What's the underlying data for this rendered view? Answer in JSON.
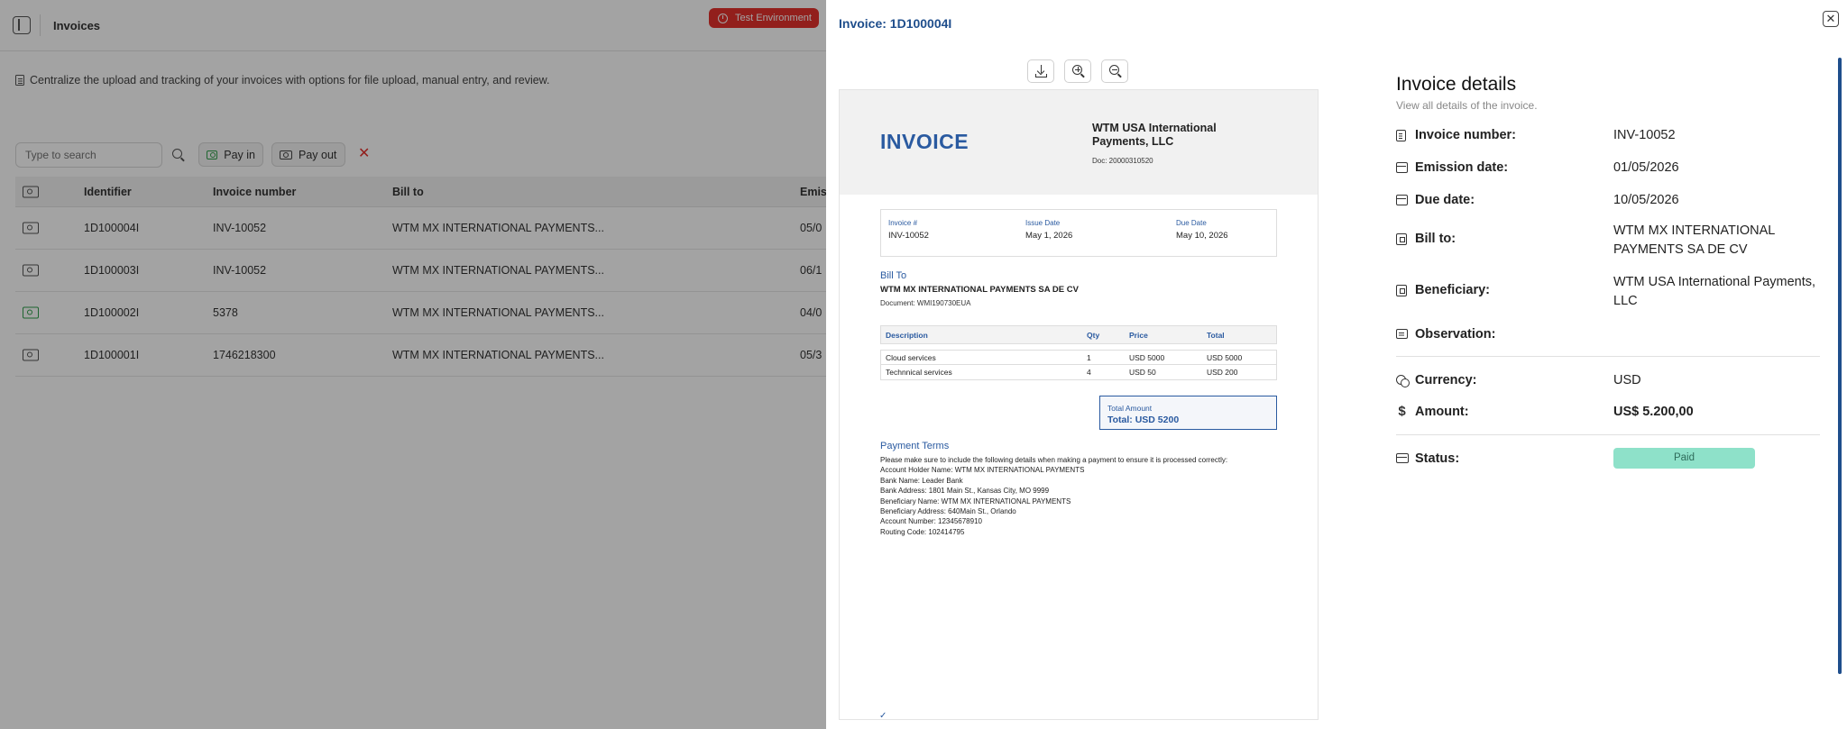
{
  "app": {
    "page_title": "Invoices",
    "environment_badge": "Test Environment",
    "description": "Centralize the upload and tracking of your invoices with options for file upload, manual entry, and review.",
    "search": {
      "placeholder": "Type to search"
    },
    "filters": {
      "pay_in": "Pay in",
      "pay_out": "Pay out"
    },
    "table": {
      "headers": {
        "identifier": "Identifier",
        "invoice_number": "Invoice number",
        "bill_to": "Bill to",
        "emission": "Emis"
      },
      "rows": [
        {
          "identifier": "1D100004I",
          "invoice_number": "INV-10052",
          "bill_to": "WTM MX INTERNATIONAL PAYMENTS...",
          "emission": "05/0",
          "direction": "pay-out"
        },
        {
          "identifier": "1D100003I",
          "invoice_number": "INV-10052",
          "bill_to": "WTM MX INTERNATIONAL PAYMENTS...",
          "emission": "06/1",
          "direction": "pay-out"
        },
        {
          "identifier": "1D100002I",
          "invoice_number": "5378",
          "bill_to": "WTM MX INTERNATIONAL PAYMENTS...",
          "emission": "04/0",
          "direction": "pay-in"
        },
        {
          "identifier": "1D100001I",
          "invoice_number": "1746218300",
          "bill_to": "WTM MX INTERNATIONAL PAYMENTS...",
          "emission": "05/3",
          "direction": "pay-out"
        }
      ]
    }
  },
  "drawer": {
    "title": "Invoice: 1D100004I",
    "document": {
      "heading": "INVOICE",
      "company": "WTM USA International Payments, LLC",
      "doc_number": "Doc: 20000310520",
      "meta": {
        "invoice_label": "Invoice #",
        "invoice_value": "INV-10052",
        "issue_label": "Issue Date",
        "issue_value": "May 1, 2026",
        "due_label": "Due Date",
        "due_value": "May 10, 2026"
      },
      "bill_to": {
        "title": "Bill To",
        "name": "WTM MX INTERNATIONAL PAYMENTS SA DE CV",
        "document": "Document: WMI190730EUA"
      },
      "items_headers": {
        "description": "Description",
        "qty": "Qty",
        "price": "Price",
        "total": "Total"
      },
      "items": [
        {
          "description": "Cloud services",
          "qty": "1",
          "price": "USD 5000",
          "total": "USD 5000"
        },
        {
          "description": "Technnical services",
          "qty": "4",
          "price": "USD 50",
          "total": "USD 200"
        }
      ],
      "total_label": "Total Amount",
      "total_value": "Total: USD 5200",
      "payment_terms_title": "Payment Terms",
      "payment_terms_lines": [
        "Please make sure to include the following details when making a payment to ensure it is processed correctly:",
        "Account Holder Name: WTM MX INTERNATIONAL PAYMENTS",
        "Bank Name: Leader Bank",
        "Bank Address: 1801 Main St., Kansas City, MO 9999",
        "Beneficiary Name: WTM MX INTERNATIONAL PAYMENTS",
        "Beneficiary Address: 640Main St., Orlando",
        "Account Number: 12345678910",
        "Routing Code: 102414795"
      ]
    },
    "details": {
      "title": "Invoice details",
      "subtitle": "View all details of the invoice.",
      "invoice_number_label": "Invoice number:",
      "invoice_number": "INV-10052",
      "emission_date_label": "Emission date:",
      "emission_date": "01/05/2026",
      "due_date_label": "Due date:",
      "due_date": "10/05/2026",
      "bill_to_label": "Bill to:",
      "bill_to": "WTM MX INTERNATIONAL PAYMENTS SA DE CV",
      "beneficiary_label": "Beneficiary:",
      "beneficiary": "WTM USA International Payments, LLC",
      "observation_label": "Observation:",
      "observation": "",
      "currency_label": "Currency:",
      "currency": "USD",
      "amount_label": "Amount:",
      "amount": "US$ 5.200,00",
      "status_label": "Status:",
      "status": "Paid",
      "status_color": "#8ee1c9"
    }
  }
}
